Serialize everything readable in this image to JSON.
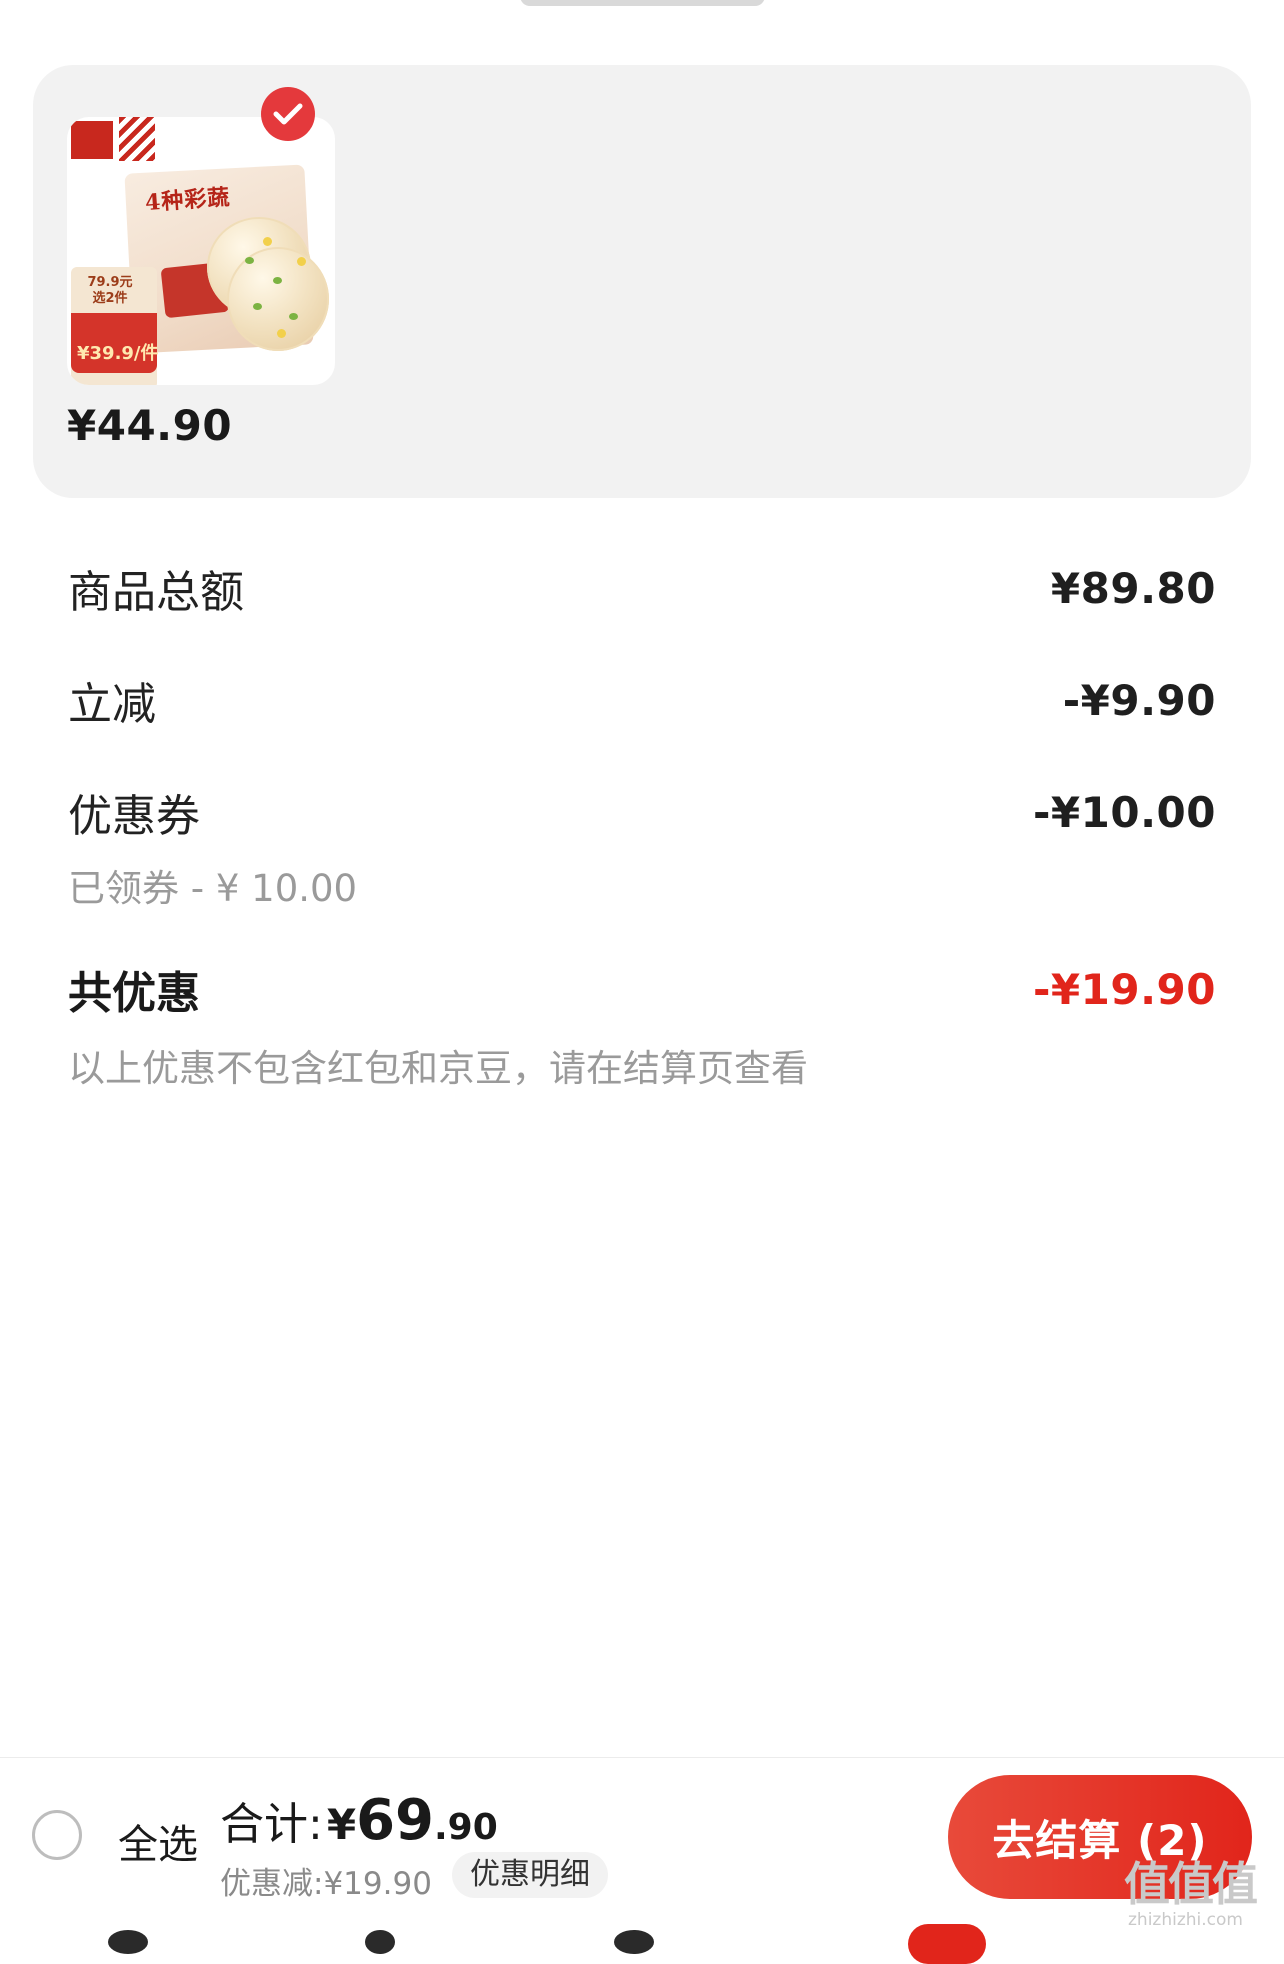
{
  "product": {
    "price": "¥44.90",
    "image_text": {
      "package_title": "4种彩蔬",
      "promo_top_line1": "79.9元",
      "promo_top_line2": "选2件",
      "promo_price": "¥39.9/件"
    },
    "selected": true
  },
  "summary": {
    "items_total_label": "商品总额",
    "items_total_value": "¥89.80",
    "direct_discount_label": "立减",
    "direct_discount_value": "-¥9.90",
    "coupon_label": "优惠券",
    "coupon_value": "-¥10.00",
    "coupon_note": "已领券 - ¥ 10.00",
    "total_saving_label": "共优惠",
    "total_saving_value": "-¥19.90",
    "saving_note": "以上优惠不包含红包和京豆，请在结算页查看"
  },
  "bottom_bar": {
    "select_all_label": "全选",
    "sum_label": "合计:",
    "sum_currency": "¥",
    "sum_integer": "69",
    "sum_decimal": ".90",
    "discount_text": "优惠减:¥19.90",
    "discount_detail_label": "优惠明细",
    "checkout_label": "去结算 (2)"
  },
  "watermark": {
    "text": "值值值",
    "url": "zhizhizhi.com"
  },
  "colors": {
    "accent_red": "#e1251b",
    "card_bg": "#f2f2f2",
    "muted_text": "#9a9a9a"
  },
  "icons": {
    "check": "check-circle-icon",
    "select_all": "radio-circle-icon"
  }
}
